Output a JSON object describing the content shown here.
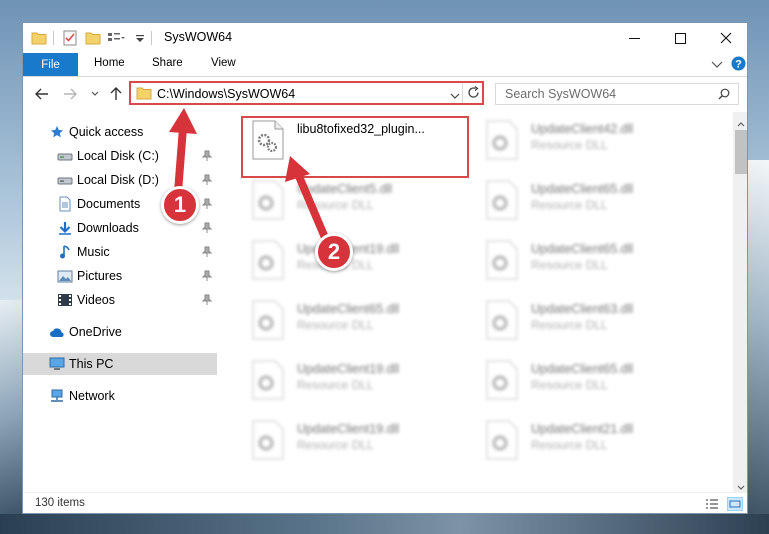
{
  "window": {
    "title": "SysWOW64",
    "controls": {
      "minimize": "minimize",
      "maximize": "maximize",
      "close": "close"
    }
  },
  "ribbon": {
    "tabs": [
      "File",
      "Home",
      "Share",
      "View"
    ]
  },
  "address": {
    "path": "C:\\Windows\\SysWOW64"
  },
  "search": {
    "placeholder": "Search SysWOW64"
  },
  "navigation": {
    "items": [
      {
        "label": "Quick access",
        "icon": "star-icon"
      },
      {
        "label": "Local Disk (C:)",
        "icon": "drive-icon",
        "pinned": true
      },
      {
        "label": "Local Disk (D:)",
        "icon": "drive-icon",
        "pinned": true
      },
      {
        "label": "Documents",
        "icon": "documents-icon",
        "pinned": true
      },
      {
        "label": "Downloads",
        "icon": "download-icon",
        "pinned": true
      },
      {
        "label": "Music",
        "icon": "music-icon",
        "pinned": true
      },
      {
        "label": "Pictures",
        "icon": "pictures-icon",
        "pinned": true
      },
      {
        "label": "Videos",
        "icon": "videos-icon",
        "pinned": true
      },
      {
        "label": "OneDrive",
        "icon": "cloud-icon"
      },
      {
        "label": "This PC",
        "icon": "computer-icon",
        "selected": true
      },
      {
        "label": "Network",
        "icon": "network-icon"
      }
    ]
  },
  "files": [
    {
      "name": "libu8tofixed32_plugin...",
      "type": ""
    },
    {
      "name": "UpdateClient42.dll",
      "type": "Resource DLL"
    },
    {
      "name": "UpdateClient5.dll",
      "type": "Resource DLL"
    },
    {
      "name": "UpdateClient65.dll",
      "type": "Resource DLL"
    },
    {
      "name": "UpdateClient19.dll",
      "type": "Resource DLL"
    },
    {
      "name": "UpdateClient65.dll",
      "type": "Resource DLL"
    },
    {
      "name": "UpdateClient65.dll",
      "type": "Resource DLL"
    },
    {
      "name": "UpdateClient63.dll",
      "type": "Resource DLL"
    },
    {
      "name": "UpdateClient19.dll",
      "type": "Resource DLL"
    },
    {
      "name": "UpdateClient65.dll",
      "type": "Resource DLL"
    },
    {
      "name": "UpdateClient19.dll",
      "type": "Resource DLL"
    },
    {
      "name": "UpdateClient21.dll",
      "type": "Resource DLL"
    }
  ],
  "status": {
    "item_count": "130 items"
  },
  "annotations": {
    "step1": "1",
    "step2": "2"
  },
  "colors": {
    "accent": "#1979ca",
    "annotation": "#d6333a"
  }
}
